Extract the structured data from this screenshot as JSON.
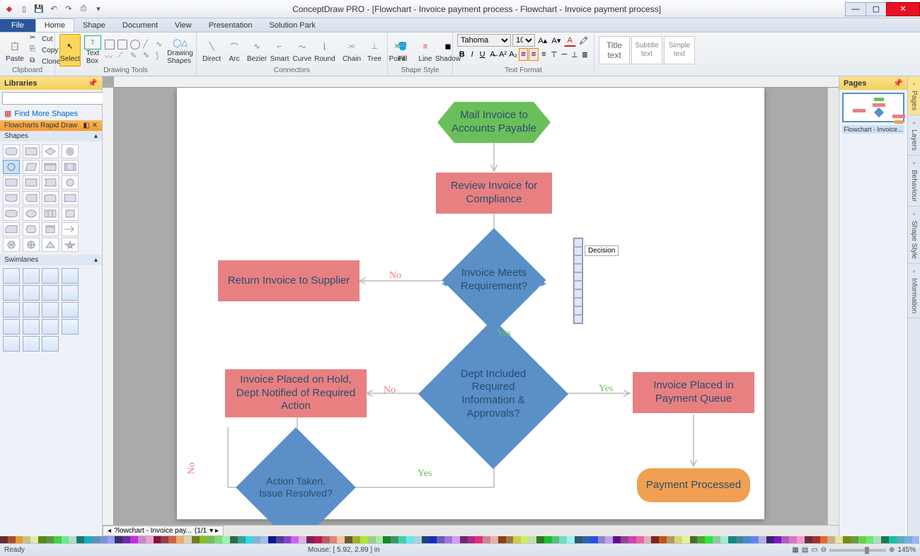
{
  "app": {
    "title": "ConceptDraw PRO - [Flowchart - Invoice payment process - Flowchart - Invoice payment process]"
  },
  "tabs": {
    "file": "File",
    "list": [
      "Home",
      "Shape",
      "Document",
      "View",
      "Presentation",
      "Solution Park"
    ],
    "active": "Home"
  },
  "ribbon": {
    "clipboard": {
      "paste": "Paste",
      "cut": "Cut",
      "copy": "Copy",
      "clone": "Clone",
      "label": "Clipboard"
    },
    "drawing": {
      "select": "Select",
      "textbox": "Text\nBox",
      "shapes": "Drawing\nShapes",
      "label": "Drawing Tools"
    },
    "connectors": {
      "direct": "Direct",
      "arc": "Arc",
      "bezier": "Bezier",
      "smart": "Smart",
      "curve": "Curve",
      "round": "Round",
      "chain": "Chain",
      "tree": "Tree",
      "point": "Point",
      "label": "Connectors"
    },
    "shapestyle": {
      "fill": "Fill",
      "line": "Line",
      "shadow": "Shadow",
      "label": "Shape Style"
    },
    "textformat": {
      "font": "Tahoma",
      "size": "10",
      "label": "Text Format"
    },
    "styles": {
      "title": "Title\ntext",
      "subtitle": "Subtitle\ntext",
      "simple": "Simple\ntext"
    }
  },
  "library": {
    "header": "Libraries",
    "find": "Find More Shapes",
    "cat": "Flowcharts Rapid Draw",
    "sub_shapes": "Shapes",
    "sub_swim": "Swimlanes"
  },
  "pages_panel": {
    "header": "Pages",
    "thumb_label": "Flowchart - Invoice..."
  },
  "sidetabs": [
    "Pages",
    "Layers",
    "Behaviour",
    "Shape Style",
    "Information"
  ],
  "flowchart": {
    "n1": "Mail Invoice to Accounts Payable",
    "n2": "Review Invoice for Compliance",
    "n3": "Invoice Meets Requirement?",
    "n4": "Return Invoice to Supplier",
    "n5": "Dept Included Required Information & Approvals?",
    "n6": "Invoice Placed on Hold, Dept Notified of Required Action",
    "n7": "Invoice Placed in Payment Queue",
    "n8": "Action Taken, Issue Resolved?",
    "n9": "Payment Processed",
    "yes": "Yes",
    "no": "No",
    "popup": "Decision"
  },
  "pagetab": {
    "name": "?lowchart - Invoice pay...",
    "num": "(1/1"
  },
  "status": {
    "ready": "Ready",
    "mouse": "Mouse: [ 5.92, 2.89 ] in",
    "zoom": "145%"
  }
}
